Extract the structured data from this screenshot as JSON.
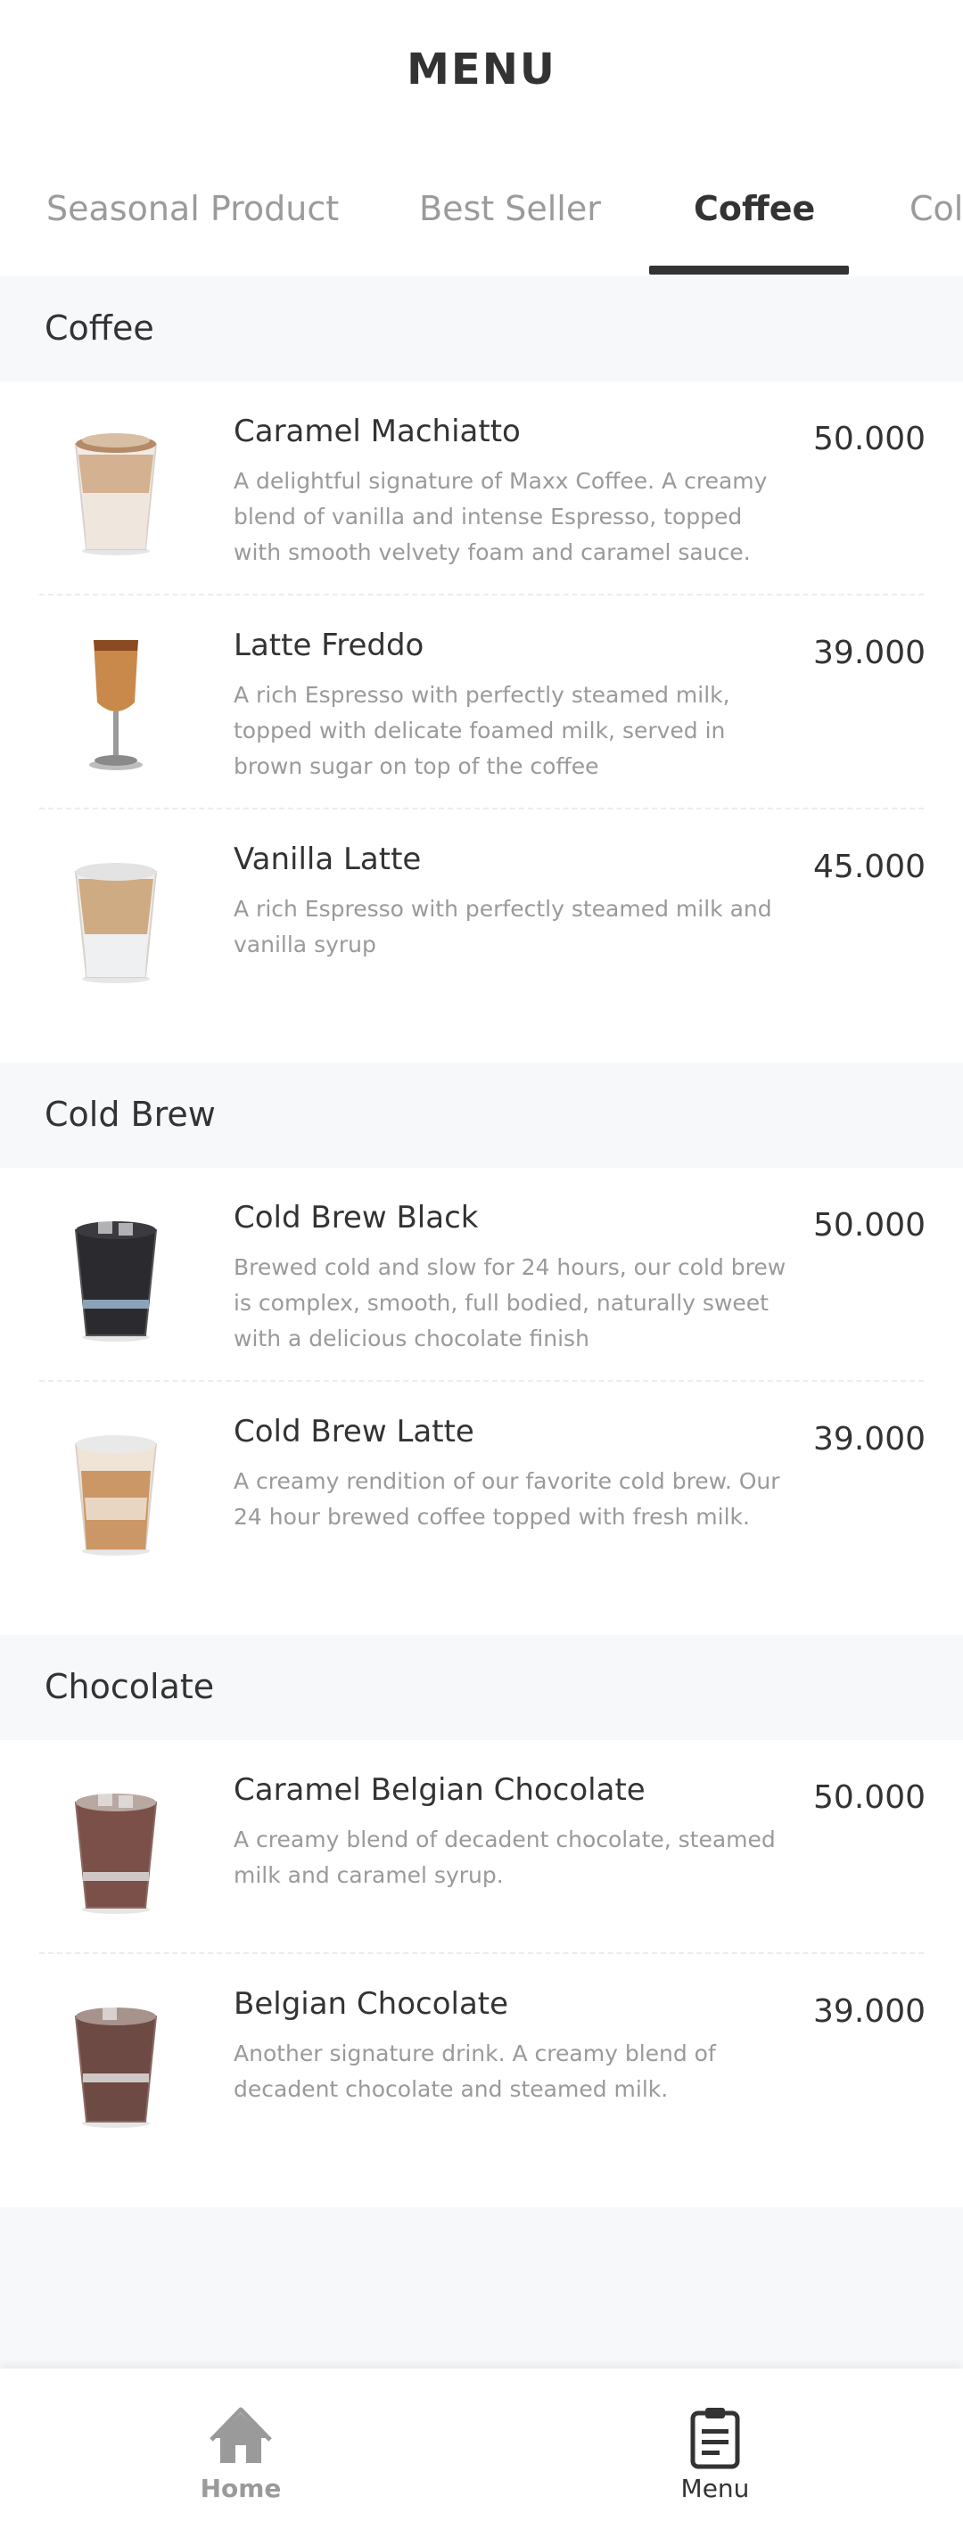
{
  "page": {
    "title": "MENU"
  },
  "tabs": [
    {
      "label": "Seasonal Product"
    },
    {
      "label": "Best Seller"
    },
    {
      "label": "Coffee"
    },
    {
      "label": "Col"
    }
  ],
  "active_tab": "Coffee",
  "sections": [
    {
      "title": "Coffee",
      "items": [
        {
          "name": "Caramel Machiatto",
          "description": "A delightful signature of Maxx Coffee. A creamy blend of vanilla and intense Espresso, topped with smooth velvety foam and caramel sauce.",
          "price": "50.000"
        },
        {
          "name": "Latte Freddo",
          "description": "A rich Espresso with perfectly steamed milk, topped with delicate foamed milk, served in brown sugar on top of the coffee",
          "price": "39.000"
        },
        {
          "name": "Vanilla Latte",
          "description": "A rich Espresso with perfectly steamed milk and vanilla syrup",
          "price": "45.000"
        }
      ]
    },
    {
      "title": "Cold Brew",
      "items": [
        {
          "name": "Cold Brew Black",
          "description": "Brewed cold and slow for 24 hours, our cold brew is complex, smooth, full bodied, naturally sweet with a delicious chocolate finish",
          "price": "50.000"
        },
        {
          "name": "Cold Brew Latte",
          "description": "A creamy rendition of our favorite cold brew. Our 24 hour brewed coffee topped with fresh milk.",
          "price": "39.000"
        }
      ]
    },
    {
      "title": "Chocolate",
      "items": [
        {
          "name": "Caramel Belgian Chocolate",
          "description": "A creamy blend of decadent chocolate, steamed milk and caramel syrup.",
          "price": "50.000"
        },
        {
          "name": "Belgian Chocolate",
          "description": "Another signature drink. A creamy blend of decadent chocolate and steamed milk.",
          "price": "39.000"
        }
      ]
    }
  ],
  "bottom_nav": {
    "home_label": "Home",
    "menu_label": "Menu",
    "home_icon": "home-icon",
    "menu_icon": "clipboard-icon"
  },
  "colors": {
    "text_dark": "#333333",
    "text_muted": "#9a9a9a",
    "background": "#f7f8fa"
  }
}
